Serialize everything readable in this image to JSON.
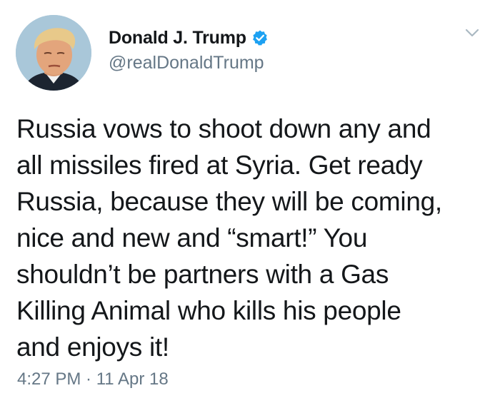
{
  "tweet": {
    "display_name": "Donald J. Trump",
    "handle": "@realDonaldTrump",
    "verified_icon": "verified-badge-icon",
    "menu_icon": "chevron-down-icon",
    "text": "Russia vows to shoot down any and\nall missiles fired at Syria. Get ready\nRussia,  because they will be coming,\nnice and new and “smart!” You\nshouldn’t be partners with a Gas\nKilling Animal who kills his people\nand enjoys it!",
    "timestamp": "4:27 PM · 11 Apr 18"
  },
  "colors": {
    "text_primary": "#14171a",
    "text_secondary": "#657786",
    "verified_blue": "#1da1f2",
    "background": "#ffffff"
  }
}
